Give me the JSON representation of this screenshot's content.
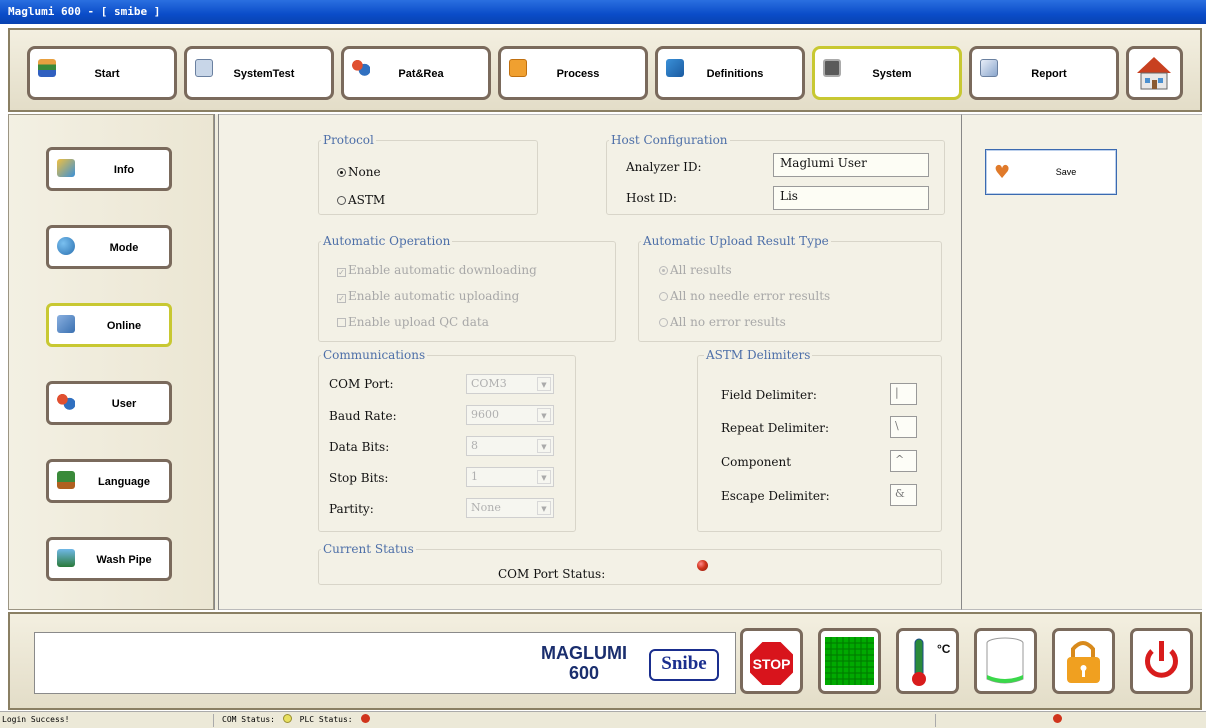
{
  "window": {
    "title": "Maglumi 600 - [ smibe ]"
  },
  "toolbar": {
    "buttons": [
      {
        "label": "Start",
        "icon": "start-icon"
      },
      {
        "label": "SystemTest",
        "icon": "system-test-icon"
      },
      {
        "label": "Pat&Rea",
        "icon": "patients-icon"
      },
      {
        "label": "Process",
        "icon": "process-icon"
      },
      {
        "label": "Definitions",
        "icon": "definitions-icon"
      },
      {
        "label": "System",
        "icon": "monitor-icon",
        "active": true
      },
      {
        "label": "Report",
        "icon": "report-icon"
      }
    ],
    "home_icon": "home-icon"
  },
  "sidebar": {
    "items": [
      {
        "label": "Info",
        "icon": "info-icon"
      },
      {
        "label": "Mode",
        "icon": "mode-icon"
      },
      {
        "label": "Online",
        "icon": "online-icon",
        "active": true
      },
      {
        "label": "User",
        "icon": "user-icon"
      },
      {
        "label": "Language",
        "icon": "language-icon"
      },
      {
        "label": "Wash Pipe",
        "icon": "wash-pipe-icon"
      }
    ]
  },
  "protocol": {
    "legend": "Protocol",
    "options": [
      {
        "label": "None",
        "selected": true
      },
      {
        "label": "ASTM",
        "selected": false
      }
    ]
  },
  "host_config": {
    "legend": "Host Configuration",
    "analyzer_id_label": "Analyzer ID:",
    "analyzer_id_value": "Maglumi User",
    "host_id_label": "Host ID:",
    "host_id_value": "Lis"
  },
  "auto_operation": {
    "legend": "Automatic Operation",
    "options": [
      {
        "label": "Enable automatic downloading",
        "checked": true
      },
      {
        "label": "Enable automatic uploading",
        "checked": true
      },
      {
        "label": "Enable upload QC data",
        "checked": false
      }
    ]
  },
  "upload_type": {
    "legend": "Automatic Upload Result Type",
    "options": [
      {
        "label": "All results",
        "selected": true
      },
      {
        "label": "All no needle error results",
        "selected": false
      },
      {
        "label": "All no error results",
        "selected": false
      }
    ]
  },
  "communications": {
    "legend": "Communications",
    "fields": [
      {
        "label": "COM Port:",
        "value": "COM3"
      },
      {
        "label": "Baud Rate:",
        "value": "9600"
      },
      {
        "label": "Data Bits:",
        "value": "8"
      },
      {
        "label": "Stop Bits:",
        "value": "1"
      },
      {
        "label": "Partity:",
        "value": "None"
      }
    ]
  },
  "astm": {
    "legend": "ASTM Delimiters",
    "fields": [
      {
        "label": "Field Delimiter:",
        "value": "|"
      },
      {
        "label": "Repeat Delimiter:",
        "value": "\\"
      },
      {
        "label": "Component",
        "value": "^"
      },
      {
        "label": "Escape Delimiter:",
        "value": "&"
      }
    ]
  },
  "current_status": {
    "legend": "Current Status",
    "com_port_status_label": "COM Port Status:",
    "led_color": "#d0341c"
  },
  "right_panel": {
    "save_label": "Save"
  },
  "brand": {
    "line1": "MAGLUMI",
    "line2": "600",
    "logo": "Snibe"
  },
  "bottom_icons": [
    "stop-icon",
    "plate-icon",
    "thermometer-icon",
    "reagent-icon",
    "lock-icon",
    "power-icon"
  ],
  "bottom_labels": {
    "stop": "STOP",
    "temp_unit": "°C"
  },
  "statusbar": {
    "message": "Login Success!",
    "com_status_label": "COM Status:",
    "plc_status_label": "PLC Status:"
  }
}
